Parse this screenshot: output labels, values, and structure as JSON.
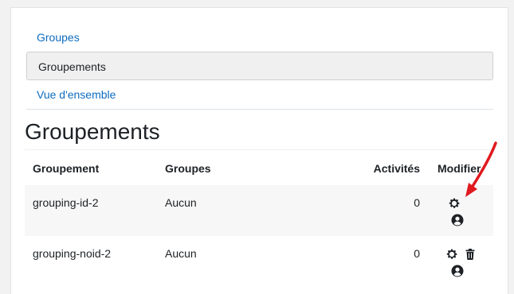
{
  "nav": {
    "groups": "Groupes",
    "groupings": "Groupements",
    "overview": "Vue d'ensemble"
  },
  "page": {
    "title": "Groupements"
  },
  "table": {
    "headers": {
      "grouping": "Groupement",
      "groups": "Groupes",
      "activities": "Activités",
      "edit": "Modifier"
    },
    "rows": [
      {
        "grouping": "grouping-id-2",
        "groups": "Aucun",
        "activities": "0",
        "actions": [
          "settings-icon",
          "user-icon"
        ]
      },
      {
        "grouping": "grouping-noid-2",
        "groups": "Aucun",
        "activities": "0",
        "actions": [
          "settings-icon",
          "trash-icon",
          "user-icon"
        ]
      }
    ]
  },
  "colors": {
    "link": "#0f6cbf",
    "annotation_arrow": "#e0191e",
    "text": "#1d2125"
  }
}
